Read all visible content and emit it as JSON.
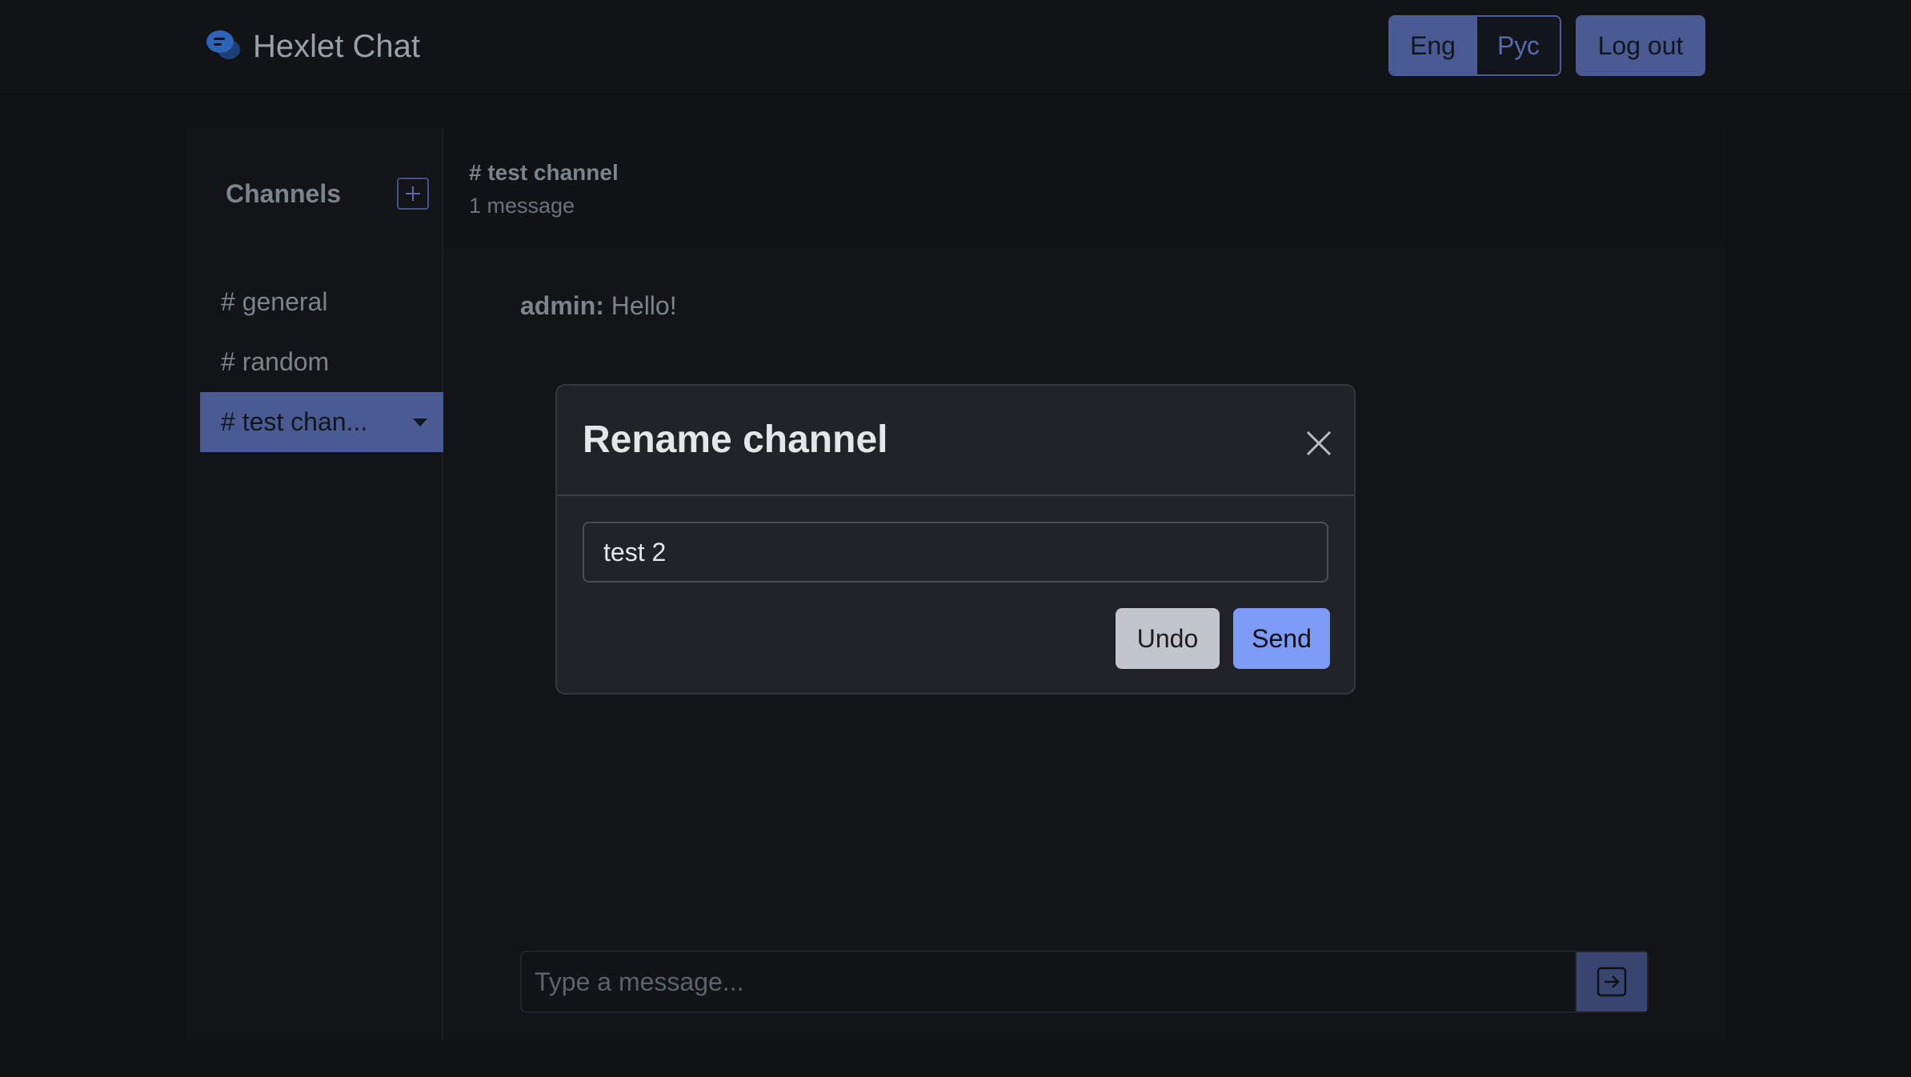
{
  "navbar": {
    "brand_name": "Hexlet Chat",
    "lang_eng": "Eng",
    "lang_rus": "Рус",
    "logout_label": "Log out"
  },
  "sidebar": {
    "header": "Channels",
    "items": [
      {
        "label": "# general"
      },
      {
        "label": "# random"
      },
      {
        "label": "# test chan..."
      }
    ]
  },
  "chat": {
    "title": "# test channel",
    "count": "1 message",
    "messages": [
      {
        "author": "admin:",
        "text": "Hello!"
      }
    ],
    "composer_placeholder": "Type a message..."
  },
  "modal": {
    "title": "Rename channel",
    "input_value": "test 2",
    "undo_label": "Undo",
    "send_label": "Send"
  },
  "colors": {
    "accent": "#4a5a93",
    "primary": "#7e9cf7",
    "background": "#0f1114"
  }
}
